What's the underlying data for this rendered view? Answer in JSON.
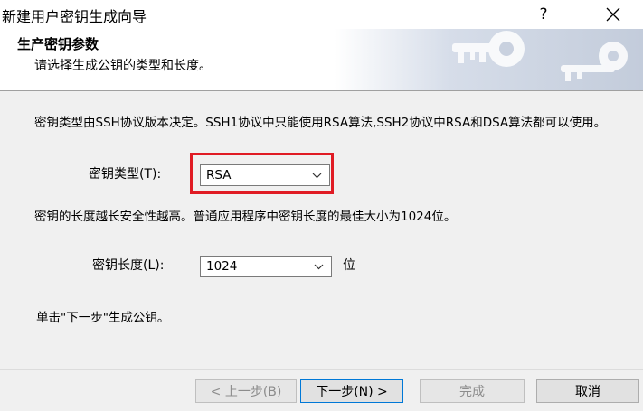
{
  "window": {
    "title": "新建用户密钥生成向导",
    "help_label": "?"
  },
  "header": {
    "title": "生产密钥参数",
    "subtitle": "请选择生成公钥的类型和长度。"
  },
  "content": {
    "intro": "密钥类型由SSH协议版本决定。SSH1协议中只能使用RSA算法,SSH2协议中RSA和DSA算法都可以使用。",
    "key_type_label": "密钥类型(T):",
    "key_type_value": "RSA",
    "length_note": "密钥的长度越长安全性越高。普通应用程序中密钥长度的最佳大小为1024位。",
    "key_length_label": "密钥长度(L):",
    "key_length_value": "1024",
    "length_unit": "位",
    "hint": "单击\"下一步\"生成公钥。"
  },
  "buttons": {
    "back": "< 上一步(B)",
    "next": "下一步(N) >",
    "finish": "完成",
    "cancel": "取消"
  },
  "colors": {
    "highlight": "#e01b24",
    "content_bg": "#f0f0f0"
  }
}
